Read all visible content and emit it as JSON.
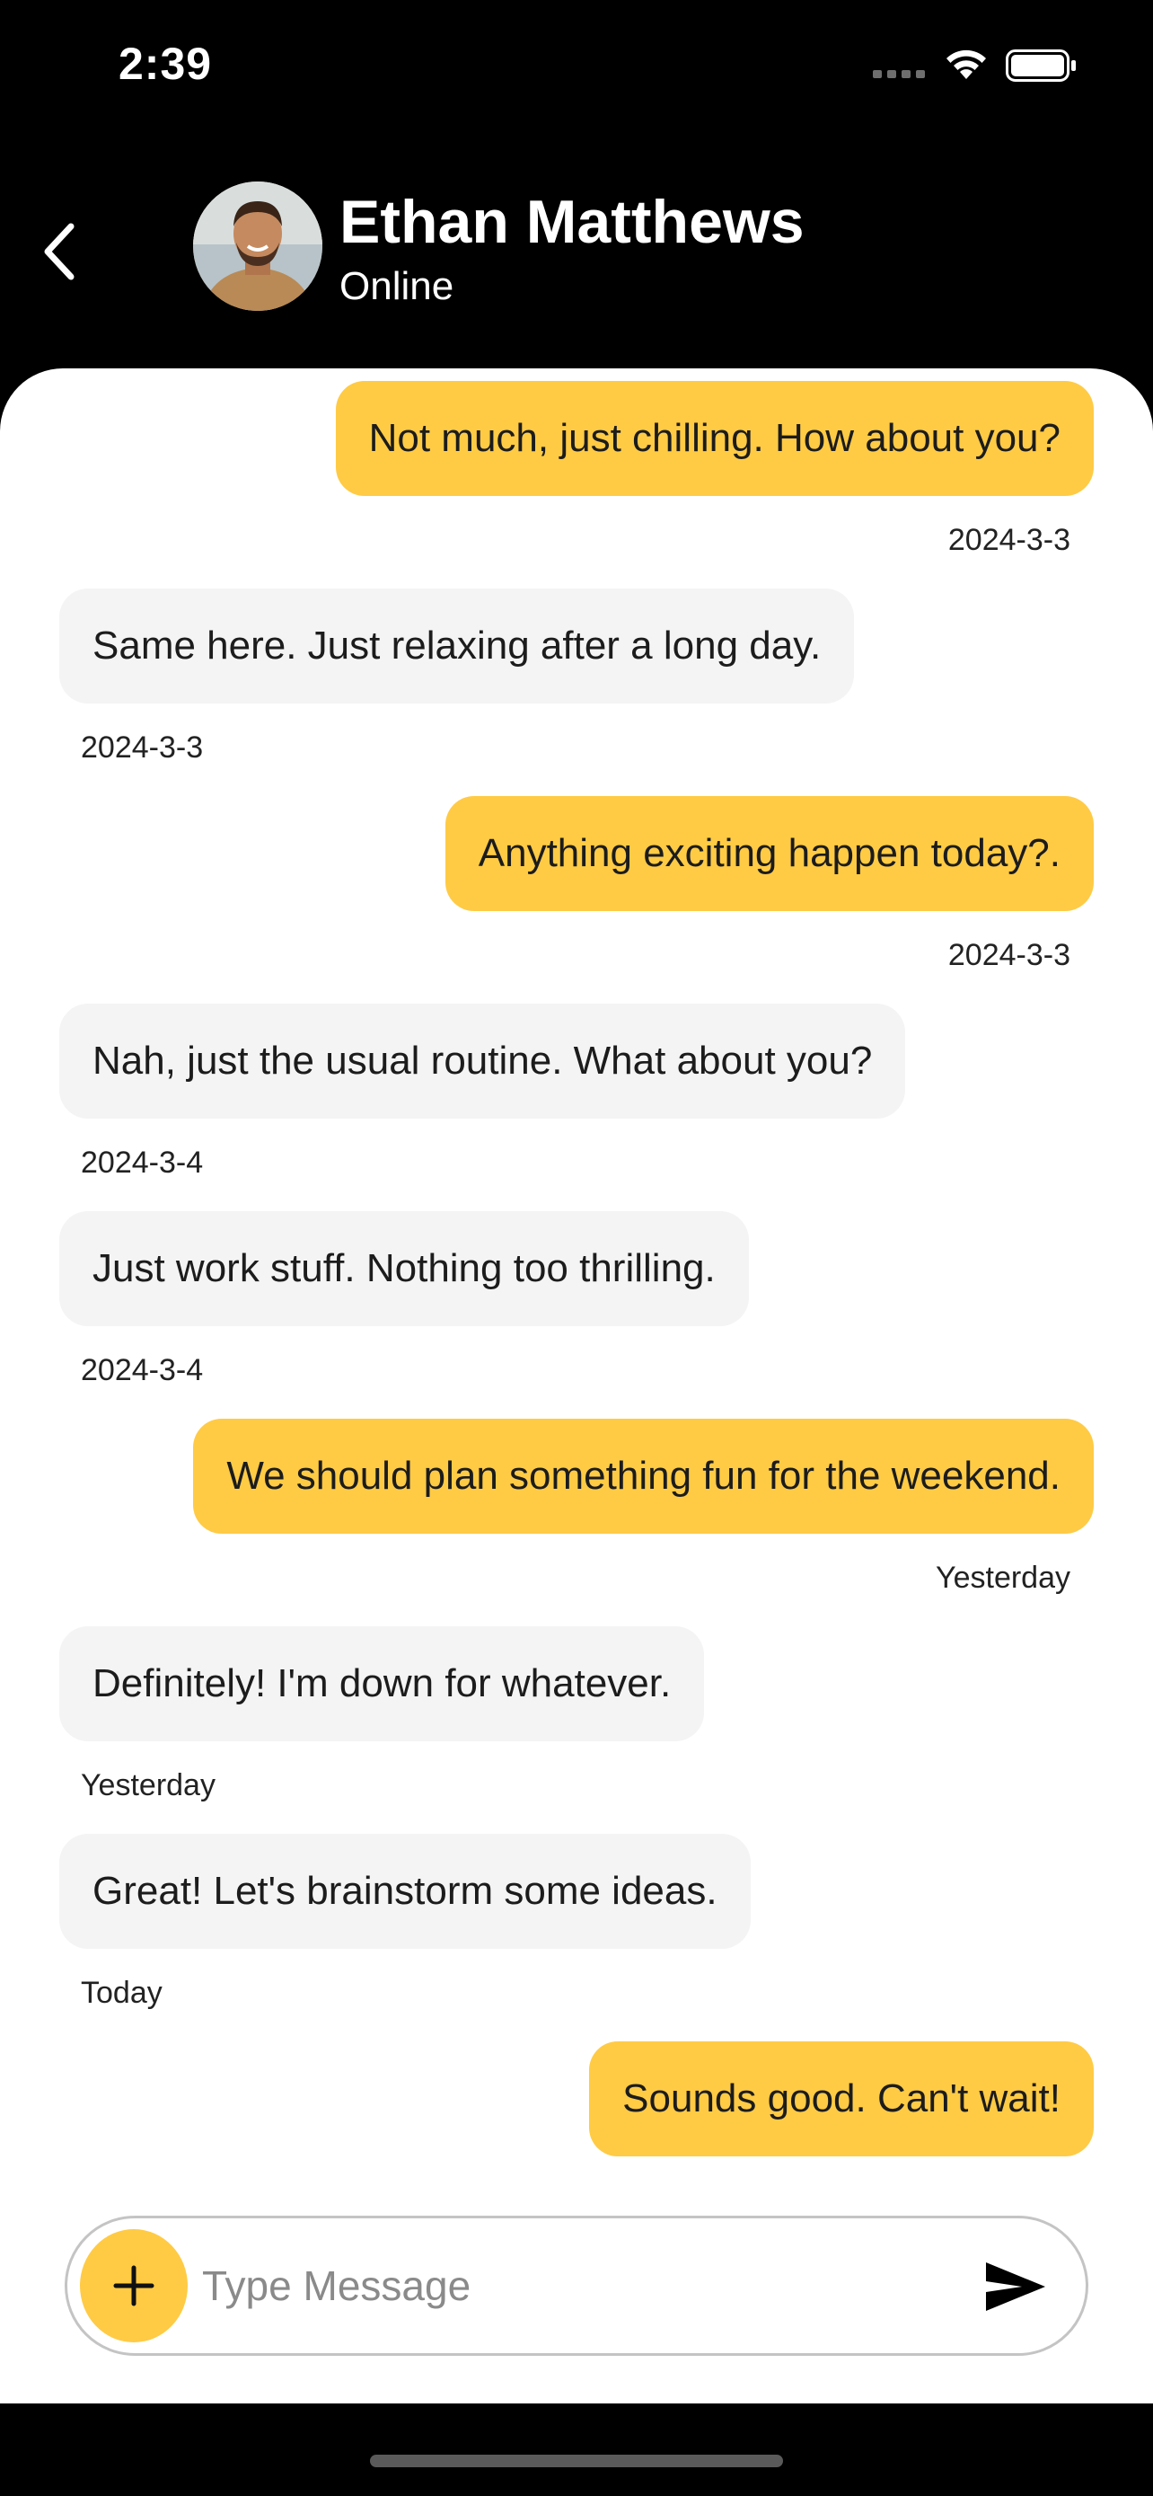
{
  "status_bar": {
    "time": "2:39"
  },
  "header": {
    "name": "Ethan Matthews",
    "status": "Online"
  },
  "messages": [
    {
      "text": "Not much, just chilling. How about you?",
      "time": "2024-3-3",
      "direction": "sent"
    },
    {
      "text": "Same here. Just relaxing after a long day.",
      "time": "2024-3-3",
      "direction": "received"
    },
    {
      "text": "Anything exciting happen today?.",
      "time": "2024-3-3",
      "direction": "sent"
    },
    {
      "text": "Nah, just the usual routine. What about you?",
      "time": "2024-3-4",
      "direction": "received"
    },
    {
      "text": "Just work stuff. Nothing too thrilling.",
      "time": "2024-3-4",
      "direction": "received"
    },
    {
      "text": "We should plan something fun for the weekend.",
      "time": "Yesterday",
      "direction": "sent"
    },
    {
      "text": "Definitely! I'm down for whatever.",
      "time": "Yesterday",
      "direction": "received"
    },
    {
      "text": "Great! Let's brainstorm some ideas.",
      "time": "Today",
      "direction": "received"
    },
    {
      "text": "Sounds good. Can't wait!",
      "time": "",
      "direction": "sent"
    }
  ],
  "composer": {
    "placeholder": "Type Message"
  },
  "colors": {
    "sent_bubble": "#ffcb45",
    "received_bubble": "#f4f4f4",
    "header_bg": "#000000"
  },
  "icons": {
    "back": "chevron-left-icon",
    "attach": "plus-icon",
    "send": "send-icon"
  }
}
